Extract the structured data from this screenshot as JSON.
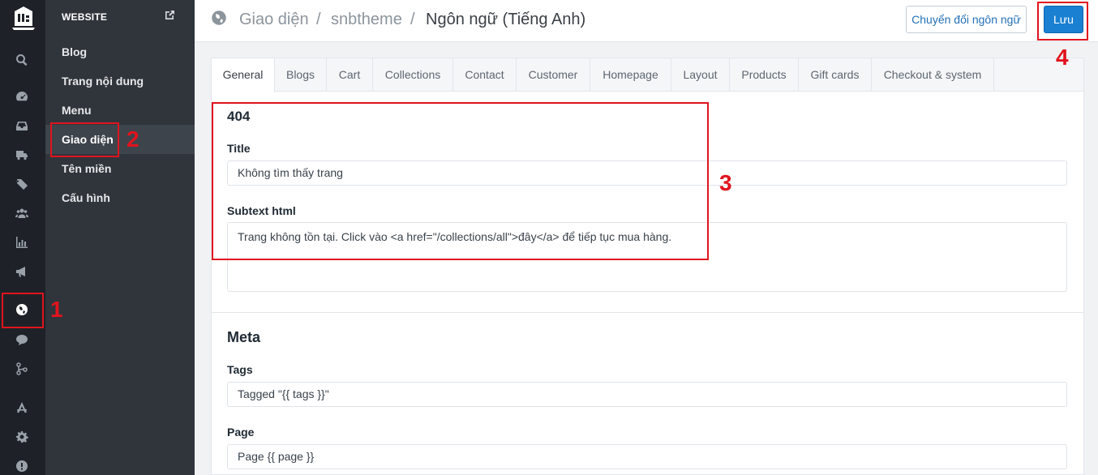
{
  "rail": {
    "icons": [
      "logo-icon",
      "search-icon",
      "dashboard-icon",
      "inbox-icon",
      "truck-icon",
      "tags-icon",
      "users-icon",
      "bar-chart-icon",
      "megaphone-icon",
      "globe-icon",
      "chat-icon",
      "git-branch-icon",
      "apps-icon",
      "gear-icon",
      "alert-icon"
    ]
  },
  "subnav": {
    "heading": "WEBSITE",
    "items": [
      {
        "label": "Blog"
      },
      {
        "label": "Trang nội dung"
      },
      {
        "label": "Menu"
      },
      {
        "label": "Giao diện"
      },
      {
        "label": "Tên miền"
      },
      {
        "label": "Cấu hình"
      }
    ],
    "active": "Giao diện"
  },
  "header": {
    "crumbs": [
      "Giao diện",
      "/",
      "snbtheme",
      "/"
    ],
    "current": "Ngôn ngữ (Tiếng Anh)",
    "switch_label": "Chuyển đổi ngôn ngữ",
    "save_label": "Lưu"
  },
  "tabs": [
    "General",
    "Blogs",
    "Cart",
    "Collections",
    "Contact",
    "Customer",
    "Homepage",
    "Layout",
    "Products",
    "Gift cards",
    "Checkout & system"
  ],
  "active_tab": "General",
  "section_404": {
    "title": "404",
    "title_label": "Title",
    "title_value": "Không tìm thấy trang",
    "subtext_label": "Subtext html",
    "subtext_value": "Trang không tồn tại. Click vào <a href=\"/collections/all\">đây</a> để tiếp tục mua hàng."
  },
  "section_meta": {
    "title": "Meta",
    "tags_label": "Tags",
    "tags_value": "Tagged \"{{ tags }}\"",
    "page_label": "Page",
    "page_value": "Page {{ page }}"
  },
  "annotations": [
    "1",
    "2",
    "3",
    "4"
  ],
  "colors": {
    "annotation": "#e0141e",
    "primary_button": "#1a80d1",
    "rail_bg": "#1e2228",
    "subnav_bg": "#30353b"
  }
}
